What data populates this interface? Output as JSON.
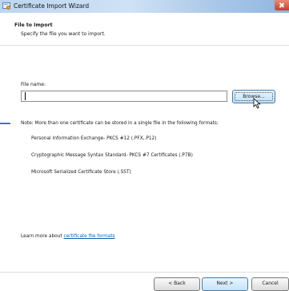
{
  "window": {
    "title": "Certificate Import Wizard"
  },
  "header": {
    "title": "File to Import",
    "subtitle": "Specify the file you want to import."
  },
  "file": {
    "label": "File name:",
    "value": "",
    "browse_label": "Browse..."
  },
  "note": "Note: More than one certificate can be stored in a single file in the following formats:",
  "formats": [
    "Personal Information Exchange- PKCS #12 (.PFX,.P12)",
    "Cryptographic Message Syntax Standard- PKCS #7 Certificates (.P7B)",
    "Microsoft Serialized Certificate Store (.SST)"
  ],
  "learn_more": {
    "prefix": "Learn more about ",
    "link": "certificate file formats"
  },
  "footer": {
    "back_label": "< Back",
    "next_label": "Next >",
    "cancel_label": "Cancel"
  },
  "colors": {
    "accent": "#2b7bd6",
    "link": "#0b5fb4",
    "close": "#c4412b"
  },
  "icons": {
    "title_icon": "certificate-icon",
    "close": "close-icon",
    "cursor": "mouse-pointer-icon"
  }
}
